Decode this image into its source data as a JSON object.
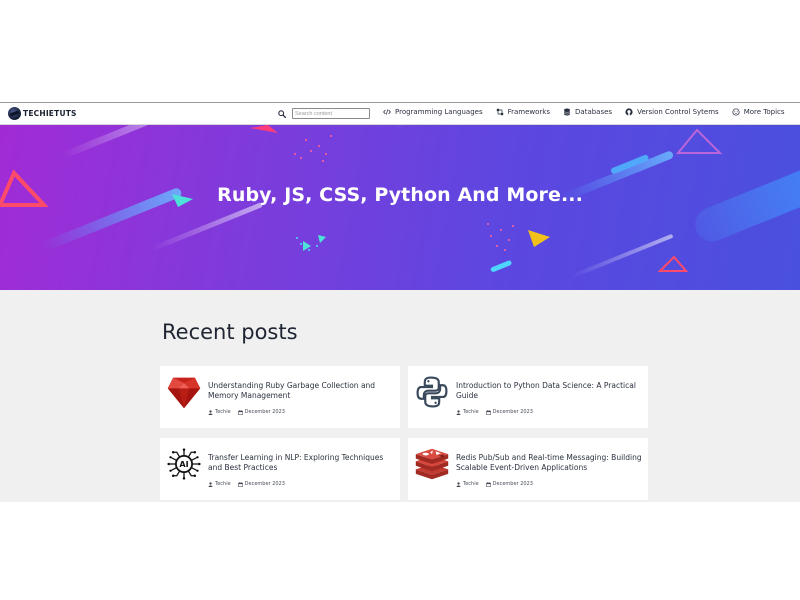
{
  "navbar": {
    "brand": "TECHIETUTS",
    "search_placeholder": "Search content",
    "items": [
      {
        "label": "Programming Languages",
        "icon": "code-icon"
      },
      {
        "label": "Frameworks",
        "icon": "framework-icon"
      },
      {
        "label": "Databases",
        "icon": "database-icon"
      },
      {
        "label": "Version Control Sytems",
        "icon": "github-icon"
      },
      {
        "label": "More Topics",
        "icon": "topics-icon"
      }
    ]
  },
  "hero": {
    "title": "Ruby, JS, CSS, Python And More..."
  },
  "recent": {
    "heading": "Recent posts",
    "posts": [
      {
        "title": "Understanding Ruby Garbage Collection and Memory Management",
        "author": "Techie",
        "date": "December 2023",
        "thumb": "ruby-logo"
      },
      {
        "title": "Introduction to Python Data Science: A Practical Guide",
        "author": "Techie",
        "date": "December 2023",
        "thumb": "python-logo"
      },
      {
        "title": "Transfer Learning in NLP: Exploring Techniques and Best Practices",
        "author": "Techie",
        "date": "December 2023",
        "thumb": "ai-chip-logo"
      },
      {
        "title": "Redis Pub/Sub and Real-time Messaging: Building Scalable Event-Driven Applications",
        "author": "Techie",
        "date": "December 2023",
        "thumb": "redis-logo"
      }
    ]
  },
  "colors": {
    "hero_start": "#a12bd6",
    "hero_end": "#4a50de",
    "page_bg": "#f0f0f0",
    "ruby_red": "#c8231b",
    "python_blue": "#3a4a5c",
    "redis_red": "#c23a31"
  }
}
